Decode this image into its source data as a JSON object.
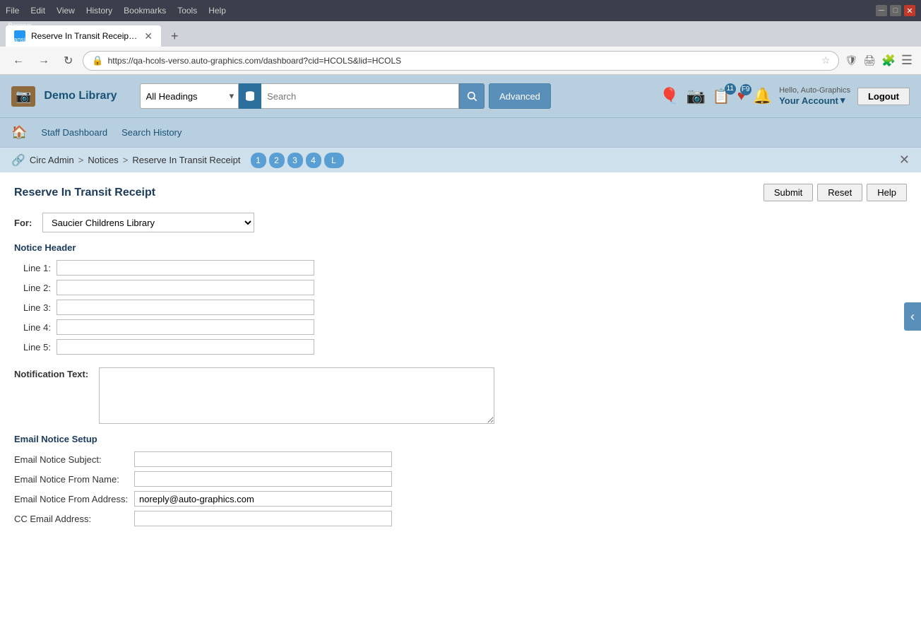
{
  "browser": {
    "menu_items": [
      "File",
      "Edit",
      "View",
      "History",
      "Bookmarks",
      "Tools",
      "Help"
    ],
    "tab_title": "Reserve In Transit Receipt | HCO",
    "tab_favicon": "R",
    "url": "https://qa-hcols-verso.auto-graphics.com/dashboard?cid=HCOLS&lid=HCOLS",
    "search_placeholder": "Search",
    "new_tab_label": "+",
    "nav_back": "←",
    "nav_forward": "→",
    "nav_refresh": "↻"
  },
  "app": {
    "library_name": "Demo Library",
    "search": {
      "headings_label": "All Headings",
      "advanced_label": "Advanced",
      "search_placeholder": ""
    },
    "top_icons": {
      "list_badge": "11",
      "heart_badge": "F9"
    },
    "user": {
      "hello": "Hello, Auto-Graphics",
      "account": "Your Account",
      "logout": "Logout"
    },
    "subnav": {
      "staff_dashboard": "Staff Dashboard",
      "search_history": "Search History"
    },
    "breadcrumb": {
      "circ_admin": "Circ Admin",
      "notices": "Notices",
      "current": "Reserve In Transit Receipt",
      "steps": [
        "1",
        "2",
        "3",
        "4",
        "L"
      ]
    },
    "page": {
      "title": "Reserve In Transit Receipt",
      "submit_btn": "Submit",
      "reset_btn": "Reset",
      "help_btn": "Help",
      "for_label": "For:",
      "for_option": "Saucier Childrens Library",
      "notice_header_label": "Notice Header",
      "line1_label": "Line 1:",
      "line2_label": "Line 2:",
      "line3_label": "Line 3:",
      "line4_label": "Line 4:",
      "line5_label": "Line 5:",
      "notification_text_label": "Notification Text:",
      "email_section_label": "Email Notice Setup",
      "email_subject_label": "Email Notice Subject:",
      "email_from_name_label": "Email Notice From Name:",
      "email_from_address_label": "Email Notice From Address:",
      "email_from_address_value": "noreply@auto-graphics.com",
      "cc_email_label": "CC Email Address:",
      "line1_value": "",
      "line2_value": "",
      "line3_value": "",
      "line4_value": "",
      "line5_value": "",
      "notification_text_value": "",
      "email_subject_value": "",
      "email_from_name_value": "",
      "cc_email_value": ""
    }
  }
}
